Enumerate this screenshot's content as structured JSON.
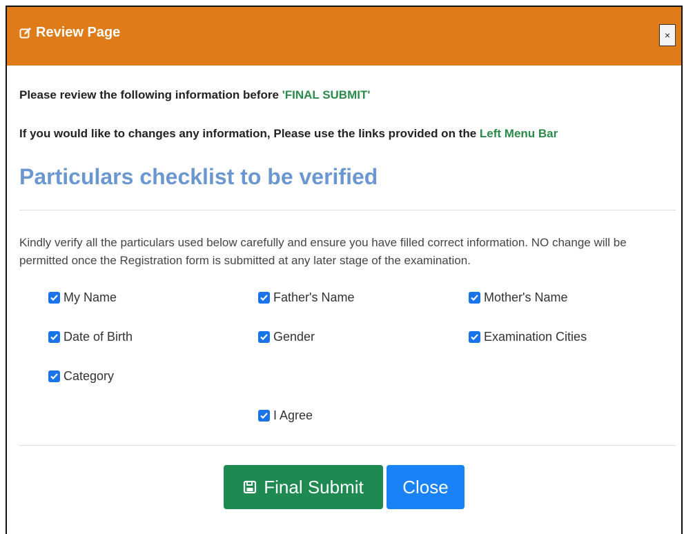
{
  "modal": {
    "title": "Review Page",
    "close_symbol": "×",
    "title_icon": "edit-icon"
  },
  "intro": {
    "line1_prefix": "Please review the following information before ",
    "line1_highlight": "'FINAL SUBMIT'",
    "line2_prefix": "If you would like to changes any information, Please use the links provided on the ",
    "line2_highlight": "Left Menu Bar"
  },
  "heading": "Particulars checklist to be verified",
  "instructions": "Kindly verify all the particulars used below carefully and ensure you have filled correct information. NO change will be permitted once the Registration form is submitted at any later stage of the examination.",
  "checklist": {
    "my_name": "My Name",
    "fathers_name": "Father's Name",
    "mothers_name": "Mother's Name",
    "dob": "Date of Birth",
    "gender": "Gender",
    "cities": "Examination Cities",
    "category": "Category",
    "agree": "I Agree"
  },
  "buttons": {
    "final_submit": "Final Submit",
    "final_submit_icon": "save-icon",
    "close": "Close"
  },
  "colors": {
    "header": "#e07b1a",
    "highlight_green": "#2a8a4a",
    "heading_blue": "#6b97d1",
    "submit_green": "#1e8a52",
    "close_blue": "#1a82f7",
    "checkbox_blue": "#1a73e8"
  }
}
